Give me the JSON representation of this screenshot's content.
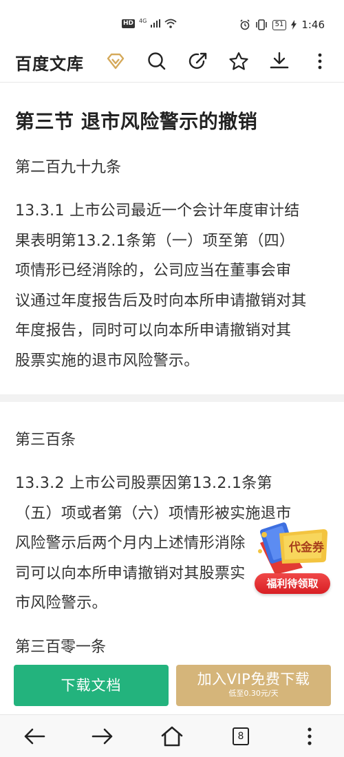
{
  "status_bar": {
    "hd": "HD",
    "network": "4G",
    "battery": "51",
    "time": "1:46"
  },
  "header": {
    "app_title": "百度文库",
    "icons": [
      "vip-diamond-icon",
      "search-icon",
      "share-icon",
      "star-icon",
      "download-icon",
      "more-icon"
    ],
    "accent_color": "#d5b57a"
  },
  "article": {
    "section_title": "第三节  退市风险警示的撤销",
    "articles": [
      {
        "label": "第二百九十九条",
        "lines": [
          "13.3.1 上市公司最近一个会计年度审计结",
          "果表明第13.2.1条第（一）项至第（四）",
          "项情形已经消除的，公司应当在董事会审",
          "议通过年度报告后及时向本所申请撤销对其",
          "年度报告，同时可以向本所申请撤销对其",
          "股票实施的退市风险警示。"
        ]
      },
      {
        "label": "第三百条",
        "lines": [
          "13.3.2 上市公司股票因第13.2.1条第",
          "（五）项或者第（六）项情形被实施退市",
          "风险警示后两个月内上述情形消除",
          "司可以向本所申请撤销对其股票实",
          "市风险警示。"
        ]
      },
      {
        "label": "第三百零一条"
      }
    ]
  },
  "coupon": {
    "badge": "代金券",
    "button": "福利待领取"
  },
  "actions": {
    "download_label": "下载文档",
    "vip_label": "加入VIP免费下载",
    "vip_sub": "低至0.30元/天",
    "download_color": "#23b37d",
    "vip_color": "#d5b57a"
  },
  "nav": {
    "tab_count": "8",
    "icons": [
      "back-arrow-icon",
      "forward-arrow-icon",
      "home-icon",
      "tabs-icon",
      "more-vertical-icon"
    ]
  }
}
